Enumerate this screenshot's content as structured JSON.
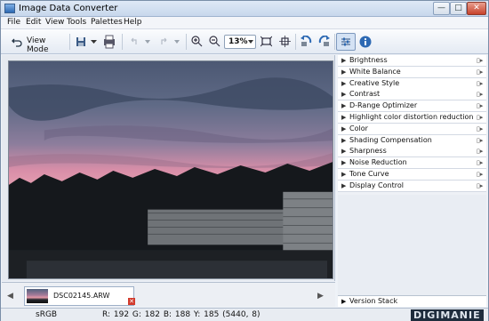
{
  "window": {
    "title": "Image Data Converter",
    "controls": [
      "—",
      "□",
      "✕"
    ]
  },
  "menu": [
    "File",
    "Edit",
    "View",
    "Tools",
    "Palettes",
    "Help"
  ],
  "toolbar": {
    "view_mode": "View Mode",
    "zoom": "13%"
  },
  "thumbnail": {
    "filename": "DSC02145.ARW"
  },
  "palettes": [
    {
      "label": "Brightness"
    },
    {
      "label": "White Balance"
    },
    {
      "label": "Creative Style"
    },
    {
      "label": "Contrast"
    },
    {
      "label": "D-Range Optimizer"
    },
    {
      "label": "Highlight color distortion reduction"
    },
    {
      "label": "Color"
    },
    {
      "label": "Shading Compensation"
    },
    {
      "label": "Sharpness"
    },
    {
      "label": "Noise Reduction"
    },
    {
      "label": "Tone Curve"
    },
    {
      "label": "Display Control"
    }
  ],
  "version_stack": "Version Stack",
  "status": {
    "color_space": "sRGB",
    "pixel_info": "R: 192  G: 182  B: 188  Y: 185   (5440,     8)"
  },
  "watermark": "DIGIMANIE",
  "colors": {
    "accent": "#2d69b3",
    "close": "#c7412a"
  }
}
